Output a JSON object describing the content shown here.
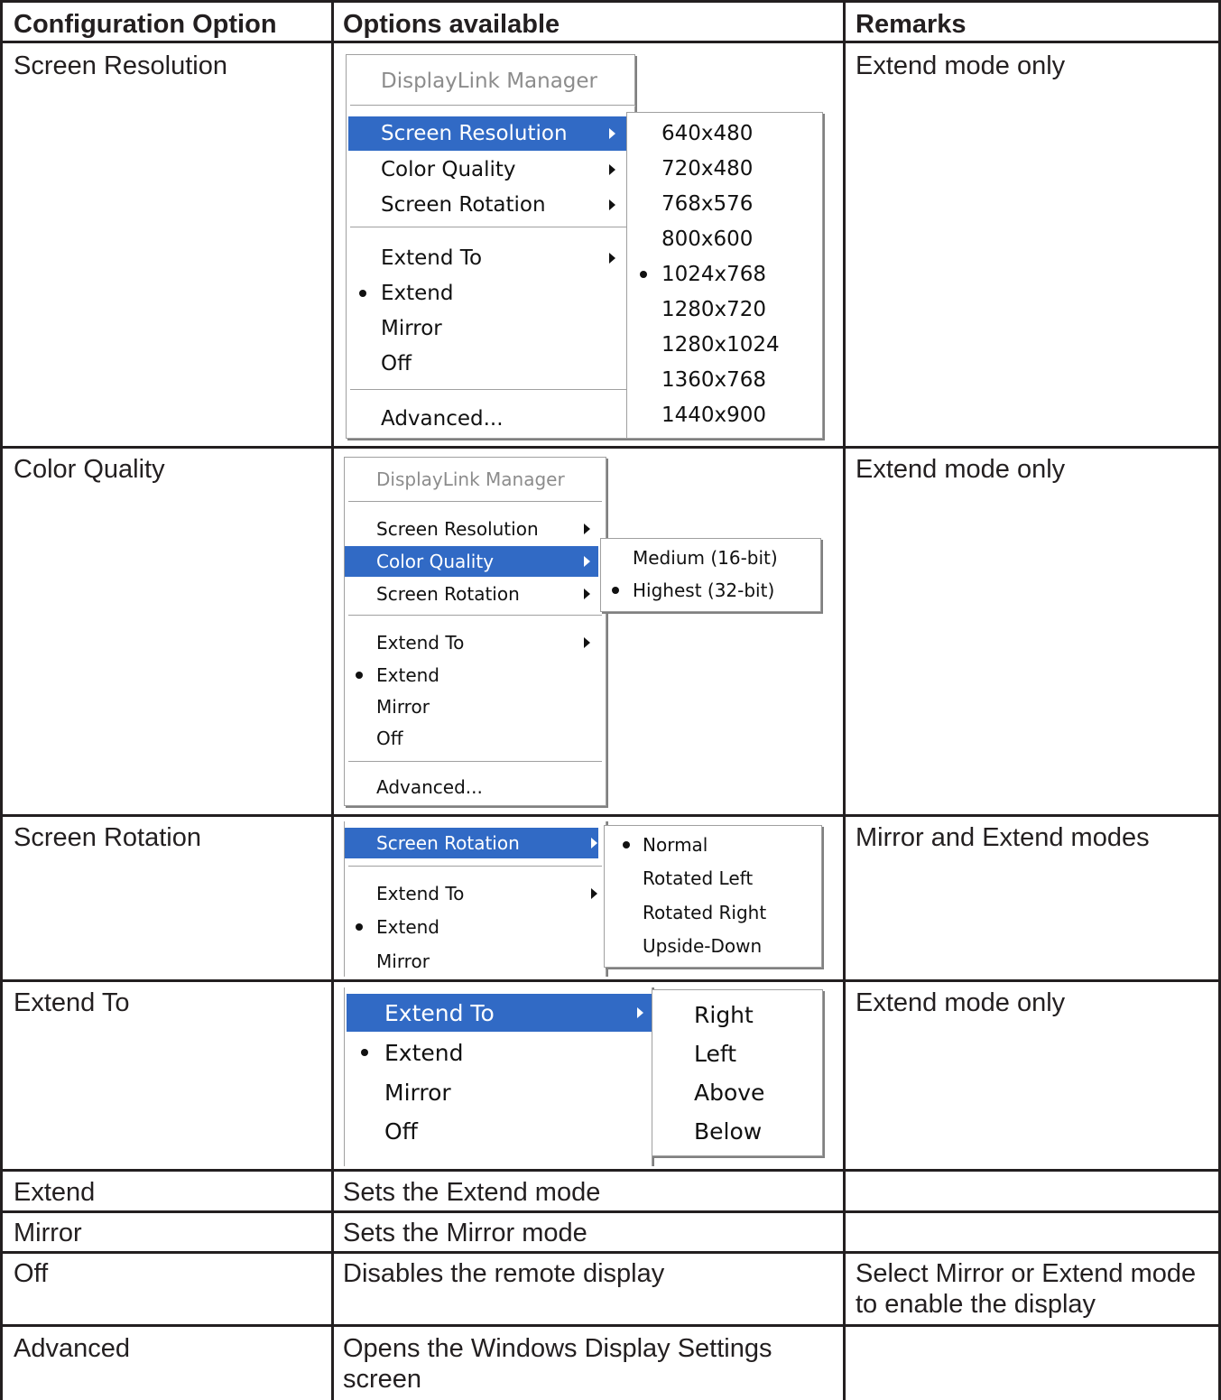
{
  "header": {
    "col1": "Configuration Option",
    "col2": "Options available",
    "col3": "Remarks"
  },
  "rows": {
    "screen_resolution": {
      "option": "Screen Resolution",
      "remarks": "Extend mode only",
      "menu": {
        "title": "DisplayLink Manager",
        "items": [
          "Screen Resolution",
          "Color Quality",
          "Screen Rotation",
          "Extend To",
          "Extend",
          "Mirror",
          "Off",
          "Advanced..."
        ],
        "submenu": [
          "640x480",
          "720x480",
          "768x576",
          "800x600",
          "1024x768",
          "1280x720",
          "1280x1024",
          "1360x768",
          "1440x900"
        ]
      }
    },
    "color_quality": {
      "option": "Color Quality",
      "remarks": "Extend mode only",
      "menu": {
        "title": "DisplayLink Manager",
        "items": [
          "Screen Resolution",
          "Color Quality",
          "Screen Rotation",
          "Extend To",
          "Extend",
          "Mirror",
          "Off",
          "Advanced..."
        ],
        "submenu": [
          "Medium (16-bit)",
          "Highest (32-bit)"
        ]
      }
    },
    "screen_rotation": {
      "option": "Screen Rotation",
      "remarks": "Mirror and Extend modes",
      "menu": {
        "items": [
          "Screen Rotation",
          "Extend To",
          "Extend",
          "Mirror"
        ],
        "submenu": [
          "Normal",
          "Rotated Left",
          "Rotated Right",
          "Upside-Down"
        ]
      }
    },
    "extend_to": {
      "option": "Extend To",
      "remarks": "Extend mode only",
      "menu": {
        "items": [
          "Extend To",
          "Extend",
          "Mirror",
          "Off"
        ],
        "submenu": [
          "Right",
          "Left",
          "Above",
          "Below"
        ]
      }
    },
    "extend": {
      "option": "Extend",
      "description": "Sets the Extend mode",
      "remarks": ""
    },
    "mirror": {
      "option": "Mirror",
      "description": "Sets the Mirror mode",
      "remarks": ""
    },
    "off": {
      "option": "Off",
      "description": "Disables the remote display",
      "remarks": "Select Mirror or Extend mode to enable the display"
    },
    "advanced": {
      "option": "Advanced",
      "description": "Opens the Windows Display Settings screen",
      "remarks": ""
    }
  },
  "colors": {
    "highlight": "#316ac5",
    "text": "#231f20",
    "menu_border": "#a0a0a0",
    "disabled_text": "#8c8c8c"
  }
}
